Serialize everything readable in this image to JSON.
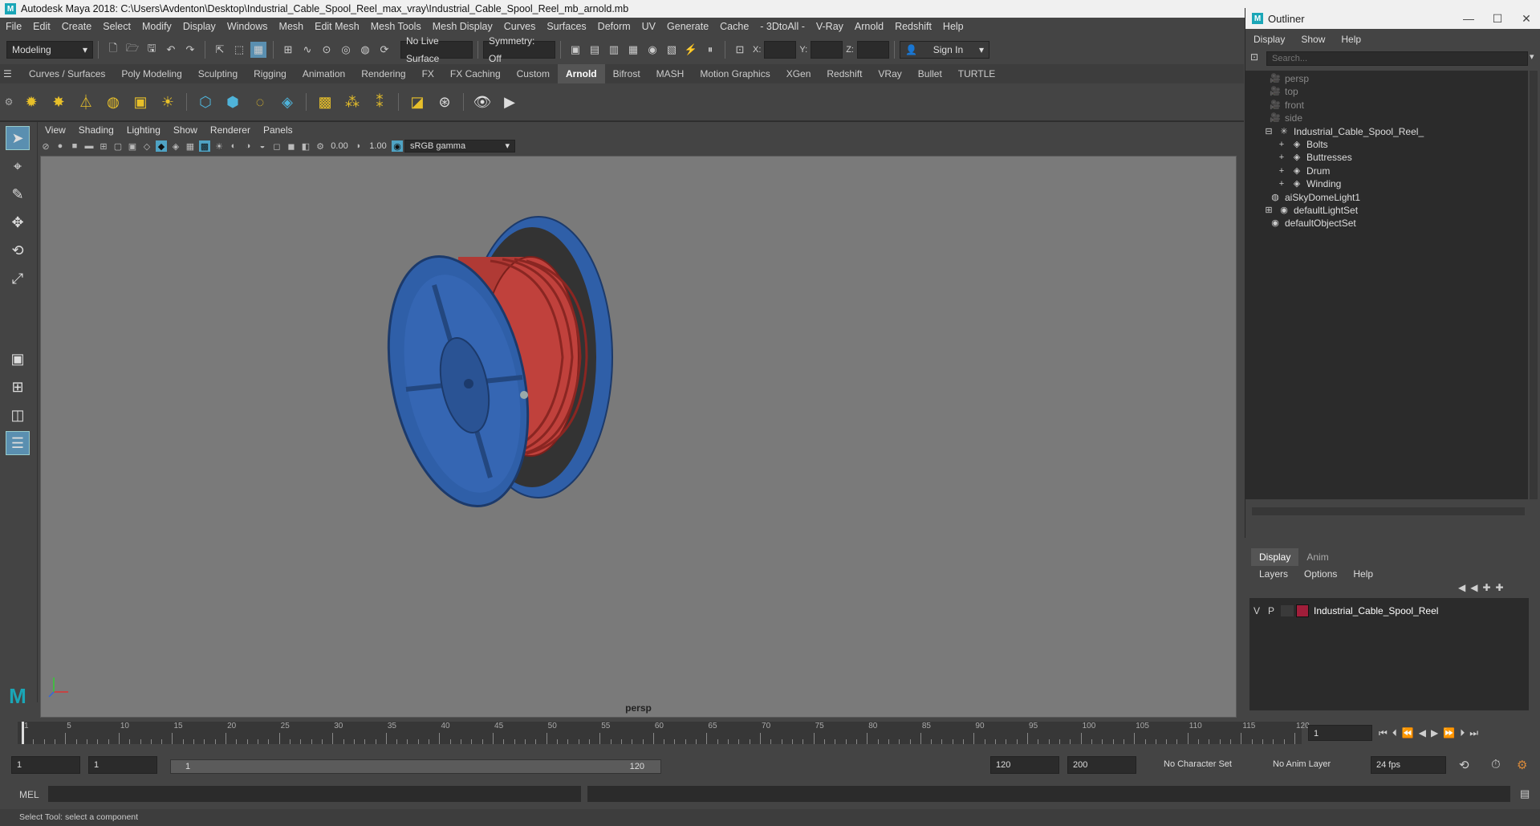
{
  "title": "Autodesk Maya 2018: C:\\Users\\Avdenton\\Desktop\\Industrial_Cable_Spool_Reel_max_vray\\Industrial_Cable_Spool_Reel_mb_arnold.mb",
  "menubar": [
    "File",
    "Edit",
    "Create",
    "Select",
    "Modify",
    "Display",
    "Windows",
    "Mesh",
    "Edit Mesh",
    "Mesh Tools",
    "Mesh Display",
    "Curves",
    "Surfaces",
    "Deform",
    "UV",
    "Generate",
    "Cache",
    "- 3DtoAll -",
    "V-Ray",
    "Arnold",
    "Redshift",
    "Help"
  ],
  "toolbar": {
    "mode": "Modeling",
    "live_surface": "No Live Surface",
    "symmetry": "Symmetry: Off",
    "x_label": "X:",
    "y_label": "Y:",
    "z_label": "Z:",
    "sign_in": "Sign In"
  },
  "shelf_tabs": [
    "Curves / Surfaces",
    "Poly Modeling",
    "Sculpting",
    "Rigging",
    "Animation",
    "Rendering",
    "FX",
    "FX Caching",
    "Custom",
    "Arnold",
    "Bifrost",
    "MASH",
    "Motion Graphics",
    "XGen",
    "Redshift",
    "VRay",
    "Bullet",
    "TURTLE"
  ],
  "shelf_active": "Arnold",
  "viewport": {
    "menu": [
      "View",
      "Shading",
      "Lighting",
      "Show",
      "Renderer",
      "Panels"
    ],
    "exposure": "0.00",
    "gamma": "1.00",
    "colorspace": "sRGB gamma",
    "camera": "persp"
  },
  "outliner": {
    "title": "Outliner",
    "menu": [
      "Display",
      "Show",
      "Help"
    ],
    "search_placeholder": "Search...",
    "items": [
      {
        "label": "persp",
        "dim": true
      },
      {
        "label": "top",
        "dim": true
      },
      {
        "label": "front",
        "dim": true
      },
      {
        "label": "side",
        "dim": true
      },
      {
        "label": "Industrial_Cable_Spool_Reel_",
        "dim": false
      },
      {
        "label": "Bolts",
        "dim": false
      },
      {
        "label": "Buttresses",
        "dim": false
      },
      {
        "label": "Drum",
        "dim": false
      },
      {
        "label": "Winding",
        "dim": false
      },
      {
        "label": "aiSkyDomeLight1",
        "dim": false
      },
      {
        "label": "defaultLightSet",
        "dim": false
      },
      {
        "label": "defaultObjectSet",
        "dim": false
      }
    ]
  },
  "layers": {
    "tabs": [
      "Display",
      "Anim"
    ],
    "menu": [
      "Layers",
      "Options",
      "Help"
    ],
    "row": {
      "v": "V",
      "p": "P",
      "name": "Industrial_Cable_Spool_Reel",
      "color": "#a01e3a"
    }
  },
  "timeline": {
    "labels": [
      "1",
      "5",
      "10",
      "15",
      "20",
      "25",
      "30",
      "35",
      "40",
      "45",
      "50",
      "55",
      "60",
      "65",
      "70",
      "75",
      "80",
      "85",
      "90",
      "95",
      "100",
      "105",
      "110",
      "115",
      "120"
    ],
    "current_frame": "1"
  },
  "range": {
    "start": "1",
    "playback_start": "1",
    "slider_start": "1",
    "slider_end": "120",
    "playback_end": "120",
    "end": "200",
    "character_set": "No Character Set",
    "anim_layer": "No Anim Layer",
    "fps": "24 fps"
  },
  "cmdline": {
    "label": "MEL"
  },
  "helpline": "Select Tool: select a component",
  "colors": {
    "spool_blue": "#2f5fa8",
    "cable_red": "#c0413c",
    "viewport_bg": "#7a7a7a"
  }
}
